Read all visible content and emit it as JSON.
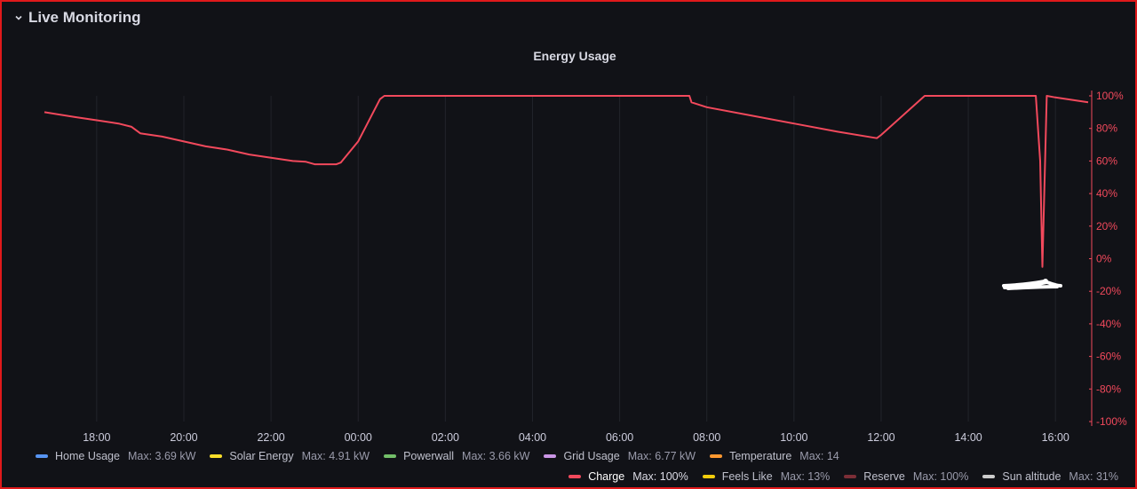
{
  "row": {
    "title": "Live Monitoring"
  },
  "panel": {
    "title": "Energy Usage"
  },
  "chart_data": {
    "type": "line",
    "title": "Energy Usage",
    "x_ticks": [
      "18:00",
      "20:00",
      "22:00",
      "00:00",
      "02:00",
      "04:00",
      "06:00",
      "08:00",
      "10:00",
      "12:00",
      "14:00",
      "16:00"
    ],
    "x_unit": "hours",
    "xlim": [
      16.8,
      40.75
    ],
    "y_ticks": [
      "100%",
      "80%",
      "60%",
      "40%",
      "20%",
      "0%",
      "-20%",
      "-40%",
      "-60%",
      "-80%",
      "-100%"
    ],
    "ylim": [
      -100,
      100
    ],
    "grid": true,
    "legend_position": "bottom",
    "series": [
      {
        "name": "Charge",
        "color": "#f2495c",
        "x": [
          16.8,
          17.5,
          18.0,
          18.5,
          18.8,
          19.0,
          19.5,
          20.0,
          20.5,
          21.0,
          21.5,
          22.0,
          22.5,
          22.8,
          23.0,
          23.5,
          23.6,
          24.0,
          24.5,
          24.6,
          26.0,
          28.0,
          30.0,
          31.6,
          31.65,
          32.0,
          33.0,
          34.0,
          35.0,
          35.9,
          36.0,
          37.0,
          37.5,
          38.0,
          39.0,
          39.55,
          39.65,
          39.7,
          39.8,
          40.0,
          40.75
        ],
        "values": [
          90,
          87,
          85,
          83,
          81,
          77,
          75,
          72,
          69,
          67,
          64,
          62,
          60,
          59.5,
          58,
          58,
          59,
          72,
          98,
          100,
          100,
          100,
          100,
          100,
          96,
          93,
          88,
          83,
          78,
          74,
          76,
          100,
          100,
          100,
          100,
          100,
          60,
          -5,
          100,
          99,
          96
        ]
      },
      {
        "name": "Home Usage",
        "color": "#5794f2",
        "x": [],
        "values": []
      },
      {
        "name": "Solar Energy",
        "color": "#fade2a",
        "x": [],
        "values": []
      },
      {
        "name": "Powerwall",
        "color": "#73bf69",
        "x": [],
        "values": []
      },
      {
        "name": "Grid Usage",
        "color": "#ca95e5",
        "x": [],
        "values": []
      },
      {
        "name": "Temperature",
        "color": "#ff9830",
        "x": [],
        "values": []
      },
      {
        "name": "Feels Like",
        "color": "#f2cc0c",
        "x": [],
        "values": []
      },
      {
        "name": "Reserve",
        "color": "#7c2e37",
        "x": [],
        "values": []
      },
      {
        "name": "Sun altitude",
        "color": "#cccccc",
        "x": [],
        "values": []
      }
    ]
  },
  "legend": {
    "row1": [
      {
        "name": "Home Usage",
        "max": "Max: 3.69 kW",
        "color": "#5794f2"
      },
      {
        "name": "Solar Energy",
        "max": "Max: 4.91 kW",
        "color": "#fade2a"
      },
      {
        "name": "Powerwall",
        "max": "Max: 3.66 kW",
        "color": "#73bf69"
      },
      {
        "name": "Grid Usage",
        "max": "Max: 6.77 kW",
        "color": "#ca95e5"
      },
      {
        "name": "Temperature",
        "max": "Max: 14",
        "color": "#ff9830"
      }
    ],
    "row2": [
      {
        "name": "Charge",
        "max": "Max: 100%",
        "color": "#f2495c"
      },
      {
        "name": "Feels Like",
        "max": "Max: 13%",
        "color": "#f2cc0c"
      },
      {
        "name": "Reserve",
        "max": "Max: 100%",
        "color": "#7c2e37"
      },
      {
        "name": "Sun altitude",
        "max": "Max: 31%",
        "color": "#cccccc"
      }
    ]
  },
  "colors": {
    "background": "#111217",
    "frame_border": "#e0191b",
    "axis_red": "#f2495c",
    "text": "#ccccdc"
  }
}
